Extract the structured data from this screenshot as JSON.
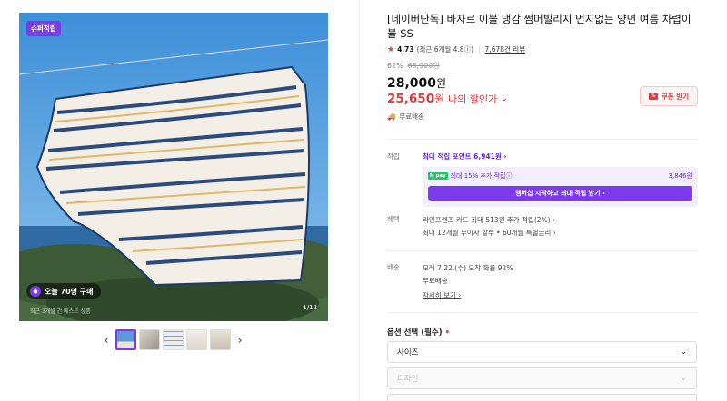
{
  "gallery": {
    "badge": "슈퍼적립",
    "buyers": "오늘 70명 구매",
    "caption": "최근 3개월 간 베스트 상품",
    "counter": "1/12",
    "prev": "‹",
    "next": "›",
    "thumb_count": 5
  },
  "product": {
    "title": "[네이버단독] 바자르 이불 냉감 썸머빌리지 먼지없는 양면 여름 차렵이불 SS",
    "rating": "4.73",
    "rating_note": "(최근 6개월 4.8ⓘ)",
    "reviews": "7,678건 리뷰",
    "discount_rate": "62%",
    "original_price": "68,900원",
    "price": "28,000",
    "price_unit": "원",
    "my_price": "25,650",
    "my_price_unit": "원",
    "my_price_label": "나의 할인가",
    "coupon": "쿠폰 받기",
    "shipping_free": "무료배송"
  },
  "points": {
    "label": "적립",
    "link": "최대 적립 포인트 6,941원 ›",
    "npay": "N pay",
    "extra": "최대 15% 추가 적립ⓘ",
    "extra_amount": "3,846원",
    "button": "멤버십 시작하고 최대 적립 받기 ›"
  },
  "benefits": {
    "label": "혜택",
    "line1": "라인프렌즈 카드 최대 513원 추가 적립(2%) ›",
    "line2": "최대 12개월 무이자 할부 • 60개월 특별금리 ›"
  },
  "delivery": {
    "label": "배송",
    "line1": "모레 7.22.(수) 도착 확률 92%",
    "line2": "무료배송",
    "detail": "자세히 보기 ›"
  },
  "options": {
    "title": "옵션 선택 (필수)",
    "required_mark": "•",
    "size": "사이즈",
    "design": "디자인"
  },
  "colors": {
    "accent": "#7c3aed",
    "sale": "#e5383b"
  }
}
